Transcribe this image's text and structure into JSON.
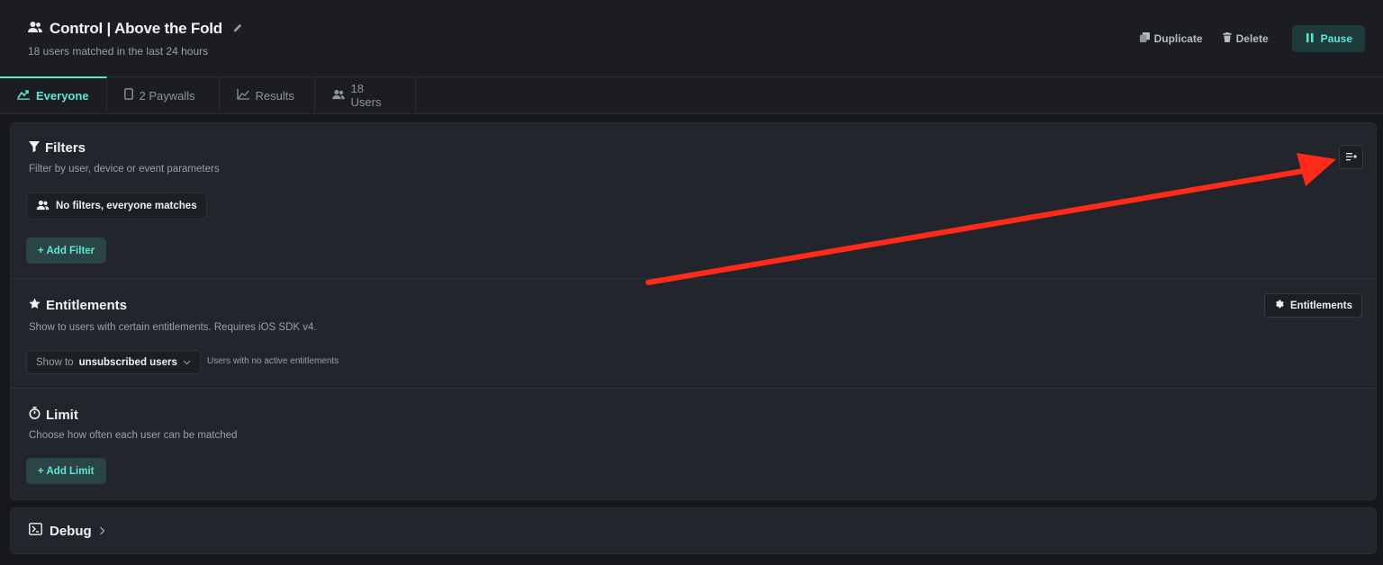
{
  "header": {
    "title": "Control | Above the Fold",
    "subtitle": "18 users matched in the last 24 hours",
    "actions": {
      "duplicate": "Duplicate",
      "delete": "Delete",
      "pause": "Pause"
    }
  },
  "tabs": [
    {
      "label": "Everyone",
      "icon": "audience-icon",
      "active": true
    },
    {
      "label": "2 Paywalls",
      "icon": "phone-icon"
    },
    {
      "label": "Results",
      "icon": "chart-line-icon"
    },
    {
      "label": "18 Users",
      "icon": "users-icon"
    }
  ],
  "filters": {
    "title": "Filters",
    "description": "Filter by user, device or event parameters",
    "status": "No filters, everyone matches",
    "add_label": "+ Add Filter"
  },
  "entitlements": {
    "title": "Entitlements",
    "description": "Show to users with certain entitlements. Requires iOS SDK v4.",
    "button_label": "Entitlements",
    "select_prefix": "Show to",
    "select_value": "unsubscribed users",
    "hint": "Users with no active entitlements"
  },
  "limit": {
    "title": "Limit",
    "description": "Choose how often each user can be matched",
    "add_label": "+ Add Limit"
  },
  "debug": {
    "title": "Debug"
  },
  "colors": {
    "accent": "#5ee7d6",
    "annotation_arrow": "#ff2a1a",
    "background": "#16181c"
  }
}
